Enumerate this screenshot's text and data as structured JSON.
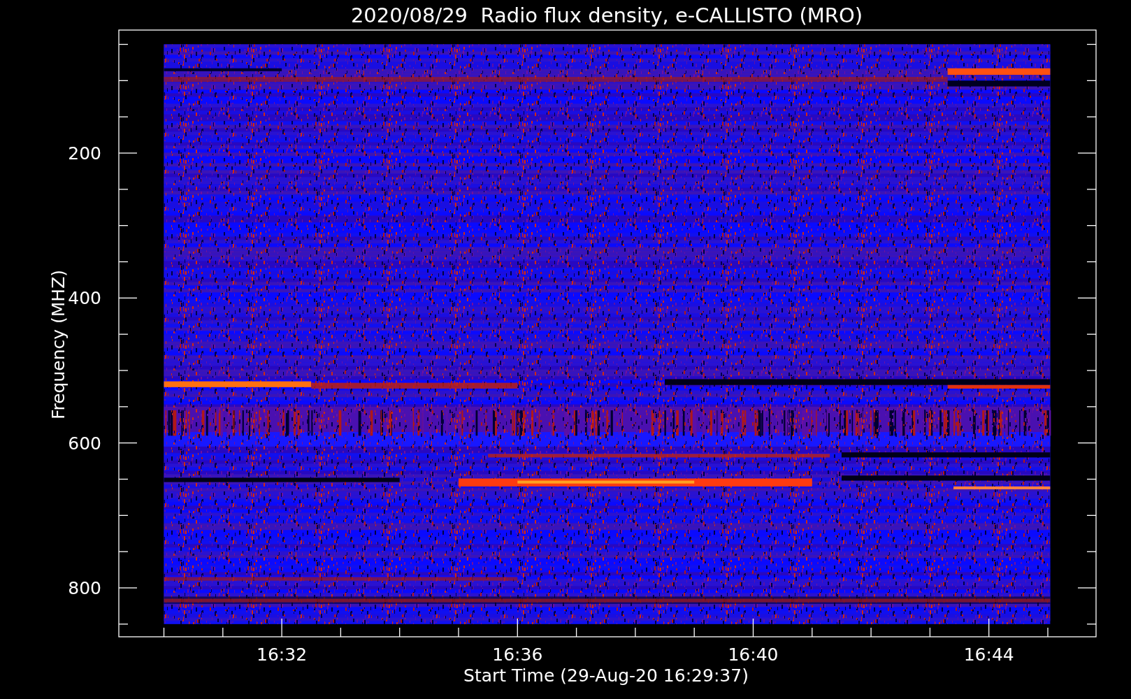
{
  "plot": {
    "title": "2020/08/29  Radio flux density, e-CALLISTO (MRO)",
    "ylabel": "Frequency (MHZ)",
    "xlabel": "Start Time (29-Aug-20 16:29:37)",
    "yticks": [
      "200",
      "400",
      "600",
      "800"
    ],
    "xticks": [
      "16:32",
      "16:36",
      "16:40",
      "16:44"
    ]
  }
}
